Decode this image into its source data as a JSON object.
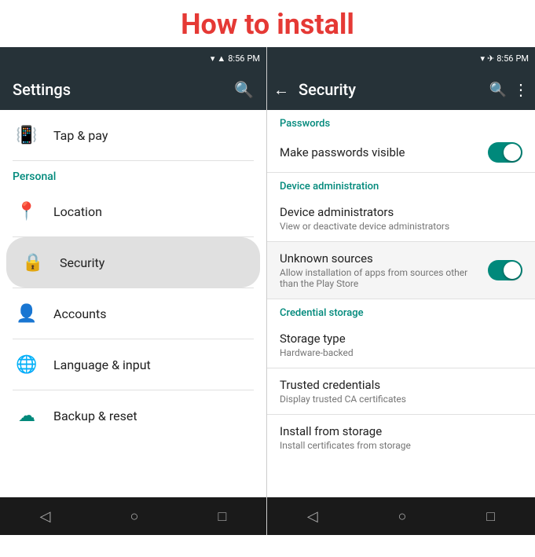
{
  "page": {
    "title": "How to install"
  },
  "left_panel": {
    "status_bar": {
      "time": "8:56",
      "pm": "PM"
    },
    "toolbar": {
      "title": "Settings",
      "search_icon": "search"
    },
    "section_personal": "Personal",
    "items": [
      {
        "id": "tap-pay",
        "label": "Tap & pay",
        "icon": "📳"
      },
      {
        "id": "location",
        "label": "Location",
        "icon": "📍"
      },
      {
        "id": "security",
        "label": "Security",
        "icon": "🔒",
        "highlighted": true
      },
      {
        "id": "accounts",
        "label": "Accounts",
        "icon": "👤"
      },
      {
        "id": "language",
        "label": "Language & input",
        "icon": "🌐"
      },
      {
        "id": "backup",
        "label": "Backup & reset",
        "icon": "☁"
      }
    ],
    "nav": {
      "back": "◁",
      "home": "○",
      "recent": "□"
    }
  },
  "right_panel": {
    "status_bar": {
      "time": "8:56",
      "pm": "PM"
    },
    "toolbar": {
      "title": "Security",
      "back_icon": "←",
      "search_icon": "search",
      "more_icon": "⋮"
    },
    "sections": [
      {
        "id": "passwords",
        "header": "Passwords",
        "items": [
          {
            "id": "make-passwords-visible",
            "title": "Make passwords visible",
            "subtitle": "",
            "has_toggle": true,
            "toggle_on": true
          }
        ]
      },
      {
        "id": "device-administration",
        "header": "Device administration",
        "items": [
          {
            "id": "device-administrators",
            "title": "Device administrators",
            "subtitle": "View or deactivate device administrators",
            "has_toggle": false
          },
          {
            "id": "unknown-sources",
            "title": "Unknown sources",
            "subtitle": "Allow installation of apps from sources other than the Play Store",
            "has_toggle": true,
            "toggle_on": true,
            "highlighted": true
          }
        ]
      },
      {
        "id": "credential-storage",
        "header": "Credential storage",
        "items": [
          {
            "id": "storage-type",
            "title": "Storage type",
            "subtitle": "Hardware-backed",
            "has_toggle": false
          },
          {
            "id": "trusted-credentials",
            "title": "Trusted credentials",
            "subtitle": "Display trusted CA certificates",
            "has_toggle": false
          },
          {
            "id": "install-from-storage",
            "title": "Install from storage",
            "subtitle": "Install certificates from storage",
            "has_toggle": false
          }
        ]
      }
    ],
    "nav": {
      "back": "◁",
      "home": "○",
      "recent": "□"
    }
  }
}
